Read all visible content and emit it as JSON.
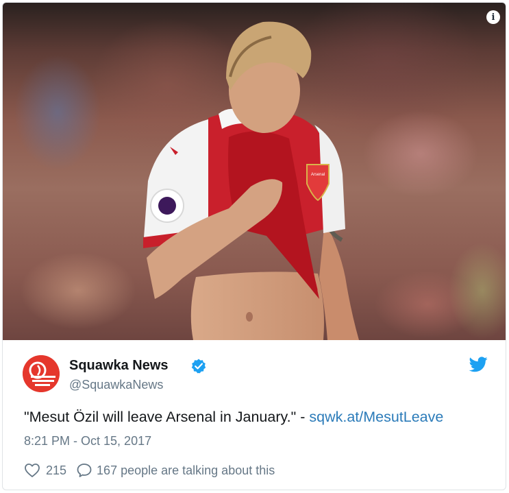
{
  "photo": {
    "info_icon": "info-icon",
    "info_glyph": "i",
    "jersey_crest_text": "Arsenal"
  },
  "tweet": {
    "avatar_icon": "squawka-logo",
    "author_name": "Squawka News",
    "verified_icon": "verified-badge-icon",
    "handle": "@SquawkaNews",
    "platform_icon": "twitter-bird-icon",
    "text": "\"Mesut Özil will leave Arsenal in January.\" - ",
    "link": "sqwk.at/MesutLeave",
    "timestamp": "8:21 PM - Oct 15, 2017",
    "likes": "215",
    "replies": "167 people are talking about this"
  },
  "colors": {
    "link": "#2b7bb9",
    "verified": "#1da1f2",
    "avatar_bg": "#e5372c",
    "secondary_text": "#657786"
  }
}
